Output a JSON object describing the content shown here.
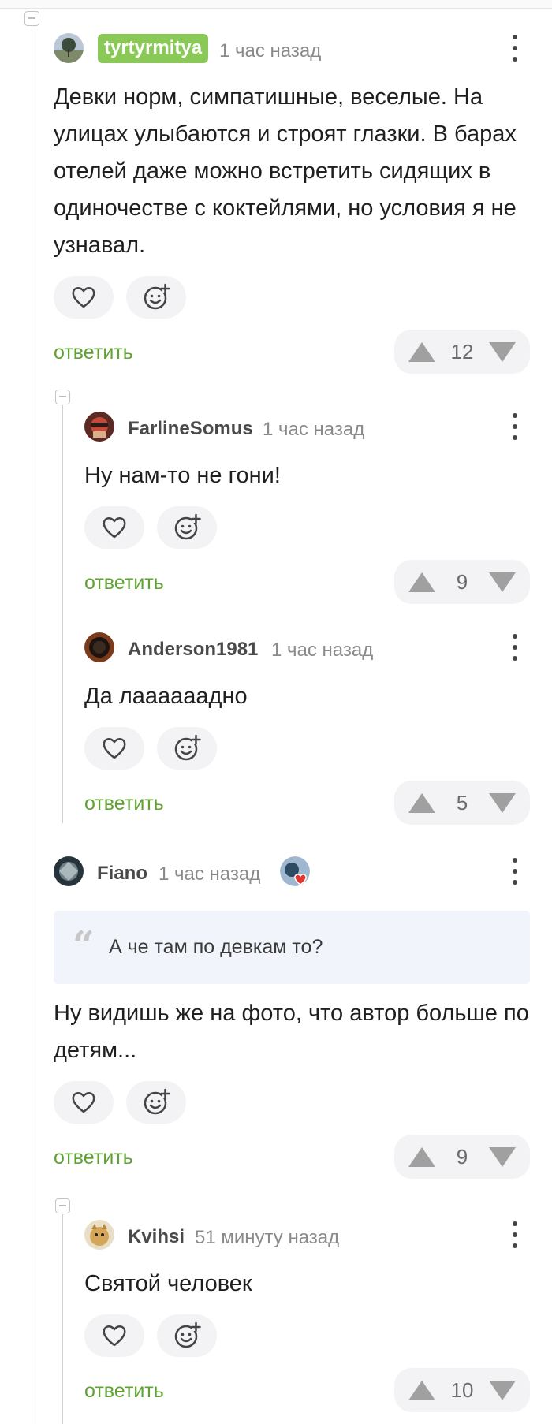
{
  "comments": [
    {
      "username": "tyrtyrmitya",
      "time": "1 час назад",
      "text": "Девки норм, симпатишные, веселые. На улицах улыбаются и строят глазки. В барах отелей даже можно встретить сидящих в одиночестве с коктейлями, но условия я не узнавал.",
      "reply_label": "ответить",
      "votes": "12"
    },
    {
      "username": "FarlineSomus",
      "time": "1 час назад",
      "text": "Ну нам-то не гони!",
      "reply_label": "ответить",
      "votes": "9"
    },
    {
      "username": "Anderson1981",
      "time": "1 час назад",
      "text": "Да лаааааадно",
      "reply_label": "ответить",
      "votes": "5"
    },
    {
      "username": "Fiano",
      "time": "1 час назад",
      "quote": "А че там по девкам то?",
      "text": "Ну видишь же на фото, что автор больше по детям...",
      "reply_label": "ответить",
      "votes": "9"
    },
    {
      "username": "Kvihsi",
      "time": "51 минуту назад",
      "text": "Святой человек",
      "reply_label": "ответить",
      "votes": "10"
    }
  ],
  "icons": {
    "like": "heart-icon",
    "emoji": "add-emoji-icon",
    "more": "more-vertical-icon",
    "upvote": "arrow-up-icon",
    "downvote": "arrow-down-icon",
    "collapse": "collapse-thread-icon",
    "quote": "quote-icon",
    "award": "award-heart-icon"
  },
  "colors": {
    "accent_green": "#5fa232",
    "badge_green": "#8ac858",
    "quote_bg": "#f2f4fb",
    "pill_bg": "#f3f3f5"
  }
}
